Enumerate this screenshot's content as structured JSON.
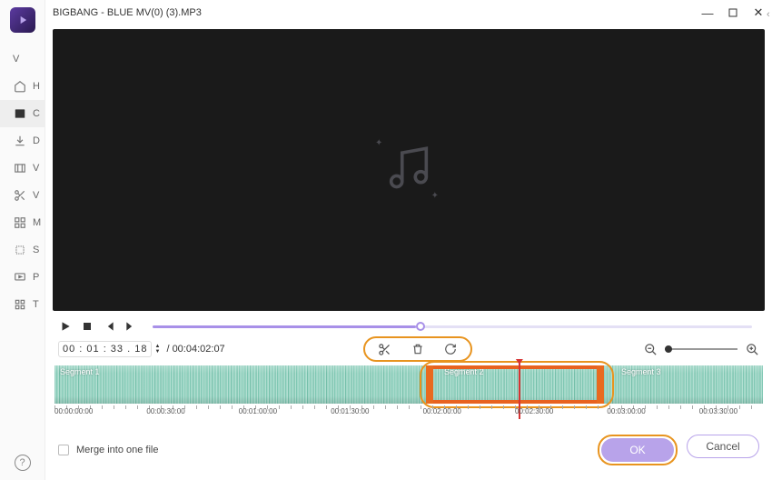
{
  "window": {
    "title": "BIGBANG - BLUE MV(0) (3).MP3",
    "collapse_char": "‹"
  },
  "sidebar": {
    "items": [
      {
        "letter": "V"
      },
      {
        "letter": "H"
      },
      {
        "letter": "C",
        "active": true
      },
      {
        "letter": "D"
      },
      {
        "letter": "V"
      },
      {
        "letter": "V"
      },
      {
        "letter": "M"
      },
      {
        "letter": "S"
      },
      {
        "letter": "P"
      },
      {
        "letter": "T"
      }
    ]
  },
  "playback": {
    "current_time": "00 : 01 : 33 . 18",
    "duration": "/ 00:04:02:07"
  },
  "timeline": {
    "segments": [
      "Segment 1",
      "Segment 2",
      "Segment 3"
    ],
    "ticks": [
      "00:00:00:00",
      "00:00:30:00",
      "00:01:00:00",
      "00:01:30:00",
      "00:02:00:00",
      "00:02:30:00",
      "00:03:00:00",
      "00:03:30:00"
    ]
  },
  "footer": {
    "merge_label": "Merge into one file",
    "ok_label": "OK",
    "cancel_label": "Cancel"
  }
}
